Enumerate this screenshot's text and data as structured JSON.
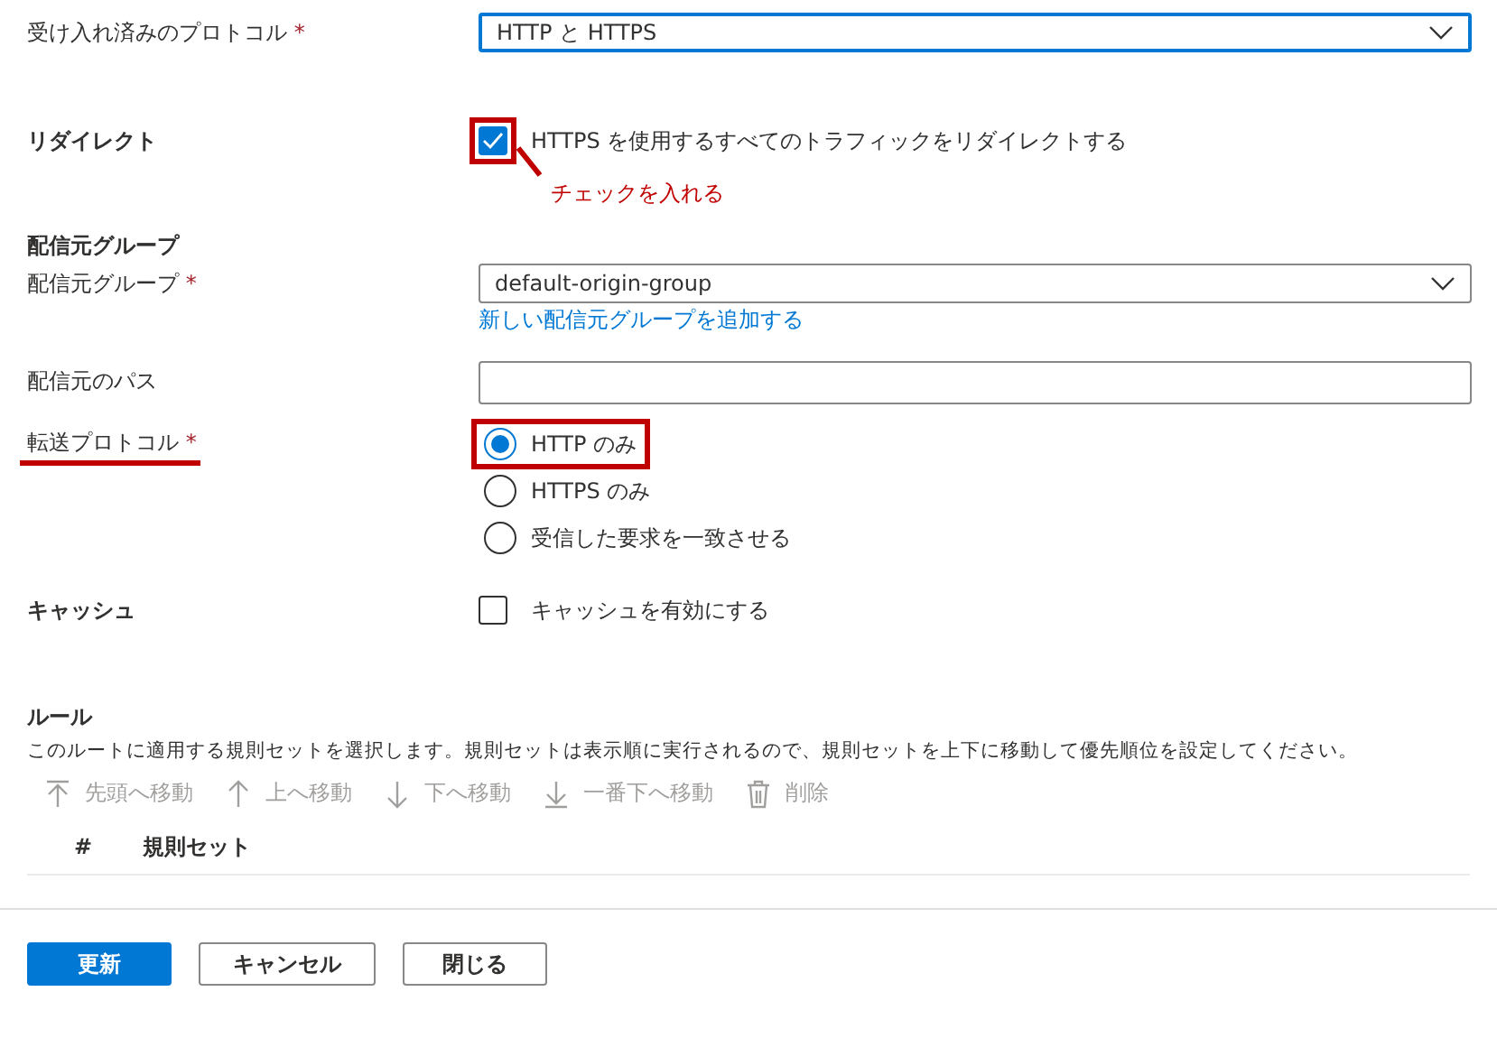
{
  "accepted_protocols": {
    "label": "受け入れ済みのプロトコル",
    "required_mark": "*",
    "value": "HTTP と HTTPS",
    "focused": true
  },
  "redirect": {
    "label": "リダイレクト",
    "checkbox": {
      "label": "HTTPS を使用するすべてのトラフィックをリダイレクトする",
      "checked": true,
      "highlighted": true
    },
    "annotation": "チェックを入れる"
  },
  "origin_group": {
    "section_title": "配信元グループ",
    "label": "配信元グループ",
    "required_mark": "*",
    "value": "default-origin-group",
    "link": "新しい配信元グループを追加する"
  },
  "origin_path": {
    "label": "配信元のパス"
  },
  "forwarding_protocol": {
    "label": "転送プロトコル",
    "required_mark": "*",
    "underlined": true,
    "options": [
      {
        "label": "HTTP のみ",
        "selected": true,
        "highlighted": true
      },
      {
        "label": "HTTPS のみ",
        "selected": false,
        "highlighted": false
      },
      {
        "label": "受信した要求を一致させる",
        "selected": false,
        "highlighted": false
      }
    ]
  },
  "caching": {
    "label": "キャッシュ",
    "checkbox": {
      "label": "キャッシュを有効にする",
      "checked": false
    }
  },
  "rules": {
    "title": "ルール",
    "description": "このルートに適用する規則セットを選択します。規則セットは表示順に実行されるので、規則セットを上下に移動して優先順位を設定してください。",
    "toolbar": [
      {
        "label": "先頭へ移動",
        "kind": "top",
        "disabled": true
      },
      {
        "label": "上へ移動",
        "kind": "up",
        "disabled": true
      },
      {
        "label": "下へ移動",
        "kind": "down",
        "disabled": true
      },
      {
        "label": "一番下へ移動",
        "kind": "bottom",
        "disabled": true
      },
      {
        "label": "削除",
        "kind": "delete",
        "disabled": true
      }
    ],
    "columns": [
      "#",
      "規則セット"
    ]
  },
  "buttons": [
    {
      "label": "更新",
      "primary": true
    },
    {
      "label": "キャンセル",
      "primary": false
    },
    {
      "label": "閉じる",
      "primary": false
    }
  ]
}
